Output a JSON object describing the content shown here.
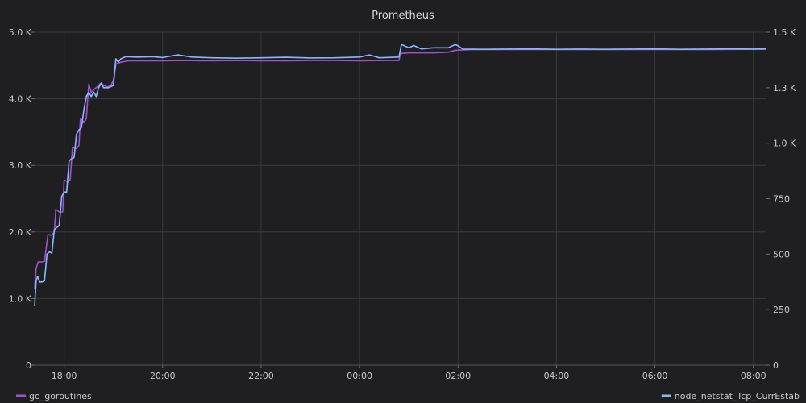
{
  "chart_data": {
    "type": "line",
    "title": "Prometheus",
    "grid": true,
    "legend": "bottom",
    "x_tick_labels": [
      "18:00",
      "20:00",
      "22:00",
      "00:00",
      "02:00",
      "04:00",
      "06:00",
      "08:00"
    ],
    "x_tick_hours": [
      18,
      20,
      22,
      24,
      26,
      28,
      30,
      32
    ],
    "x_range_hours": [
      17.4,
      32.25
    ],
    "y_left": {
      "range": [
        0,
        5000
      ],
      "tick_values": [
        0,
        1000,
        2000,
        3000,
        4000,
        5000
      ],
      "tick_labels": [
        "0",
        "1.0 K",
        "2.0 K",
        "3.0 K",
        "4.0 K",
        "5.0 K"
      ]
    },
    "y_right": {
      "range": [
        0,
        1500
      ],
      "tick_values": [
        0,
        250,
        500,
        750,
        1000,
        1250,
        1500
      ],
      "tick_labels": [
        "0",
        "250",
        "500",
        "750",
        "1.0 K",
        "1.3 K",
        "1.5 K"
      ]
    },
    "series": [
      {
        "name": "go_goroutines",
        "color": "#a352cc",
        "axis": "left",
        "points": [
          [
            17.4,
            1150
          ],
          [
            17.43,
            1450
          ],
          [
            17.47,
            1550
          ],
          [
            17.55,
            1550
          ],
          [
            17.6,
            1560
          ],
          [
            17.67,
            1960
          ],
          [
            17.75,
            1950
          ],
          [
            17.8,
            2000
          ],
          [
            17.83,
            2340
          ],
          [
            17.9,
            2300
          ],
          [
            17.97,
            2300
          ],
          [
            18.0,
            2780
          ],
          [
            18.08,
            2750
          ],
          [
            18.12,
            2780
          ],
          [
            18.17,
            3270
          ],
          [
            18.25,
            3250
          ],
          [
            18.3,
            3300
          ],
          [
            18.33,
            3700
          ],
          [
            18.4,
            3650
          ],
          [
            18.45,
            3700
          ],
          [
            18.5,
            4220
          ],
          [
            18.55,
            4100
          ],
          [
            18.62,
            4150
          ],
          [
            18.67,
            4180
          ],
          [
            18.75,
            4240
          ],
          [
            18.8,
            4200
          ],
          [
            18.88,
            4180
          ],
          [
            18.95,
            4200
          ],
          [
            19.0,
            4280
          ],
          [
            19.05,
            4520
          ],
          [
            19.15,
            4550
          ],
          [
            19.3,
            4570
          ],
          [
            19.6,
            4570
          ],
          [
            20.0,
            4570
          ],
          [
            20.5,
            4575
          ],
          [
            21.0,
            4570
          ],
          [
            21.5,
            4575
          ],
          [
            22.0,
            4570
          ],
          [
            22.5,
            4570
          ],
          [
            23.0,
            4575
          ],
          [
            23.5,
            4575
          ],
          [
            24.0,
            4570
          ],
          [
            24.5,
            4575
          ],
          [
            24.8,
            4575
          ],
          [
            24.83,
            4680
          ],
          [
            25.0,
            4690
          ],
          [
            25.5,
            4690
          ],
          [
            25.8,
            4700
          ],
          [
            25.95,
            4730
          ],
          [
            26.3,
            4740
          ],
          [
            27.0,
            4740
          ],
          [
            28.0,
            4740
          ],
          [
            29.0,
            4740
          ],
          [
            30.0,
            4740
          ],
          [
            31.0,
            4740
          ],
          [
            32.0,
            4745
          ],
          [
            32.25,
            4745
          ]
        ]
      },
      {
        "name": "node_netstat_Tcp_CurrEstab",
        "color": "#8ab8ff",
        "axis": "right",
        "points": [
          [
            17.4,
            265
          ],
          [
            17.43,
            380
          ],
          [
            17.46,
            400
          ],
          [
            17.5,
            375
          ],
          [
            17.55,
            375
          ],
          [
            17.6,
            380
          ],
          [
            17.65,
            500
          ],
          [
            17.7,
            510
          ],
          [
            17.75,
            505
          ],
          [
            17.8,
            610
          ],
          [
            17.85,
            620
          ],
          [
            17.9,
            630
          ],
          [
            17.95,
            760
          ],
          [
            18.0,
            780
          ],
          [
            18.05,
            780
          ],
          [
            18.1,
            920
          ],
          [
            18.15,
            930
          ],
          [
            18.2,
            935
          ],
          [
            18.25,
            1040
          ],
          [
            18.3,
            1060
          ],
          [
            18.35,
            1070
          ],
          [
            18.4,
            1150
          ],
          [
            18.45,
            1210
          ],
          [
            18.5,
            1230
          ],
          [
            18.55,
            1210
          ],
          [
            18.6,
            1230
          ],
          [
            18.65,
            1210
          ],
          [
            18.7,
            1250
          ],
          [
            18.75,
            1270
          ],
          [
            18.8,
            1250
          ],
          [
            18.9,
            1250
          ],
          [
            19.0,
            1260
          ],
          [
            19.05,
            1380
          ],
          [
            19.1,
            1365
          ],
          [
            19.15,
            1380
          ],
          [
            19.25,
            1390
          ],
          [
            19.5,
            1388
          ],
          [
            19.8,
            1390
          ],
          [
            20.0,
            1386
          ],
          [
            20.3,
            1398
          ],
          [
            20.6,
            1388
          ],
          [
            21.0,
            1385
          ],
          [
            21.5,
            1383
          ],
          [
            22.0,
            1385
          ],
          [
            22.5,
            1387
          ],
          [
            23.0,
            1384
          ],
          [
            23.5,
            1385
          ],
          [
            24.0,
            1388
          ],
          [
            24.2,
            1398
          ],
          [
            24.4,
            1385
          ],
          [
            24.8,
            1388
          ],
          [
            24.85,
            1445
          ],
          [
            25.0,
            1430
          ],
          [
            25.1,
            1440
          ],
          [
            25.25,
            1425
          ],
          [
            25.5,
            1430
          ],
          [
            25.8,
            1430
          ],
          [
            25.95,
            1445
          ],
          [
            26.1,
            1424
          ],
          [
            26.5,
            1423
          ],
          [
            27.0,
            1424
          ],
          [
            27.5,
            1425
          ],
          [
            28.0,
            1423
          ],
          [
            28.5,
            1424
          ],
          [
            29.0,
            1423
          ],
          [
            29.5,
            1424
          ],
          [
            30.0,
            1425
          ],
          [
            30.5,
            1423
          ],
          [
            31.0,
            1424
          ],
          [
            31.5,
            1425
          ],
          [
            32.0,
            1424
          ],
          [
            32.25,
            1425
          ]
        ]
      }
    ]
  }
}
